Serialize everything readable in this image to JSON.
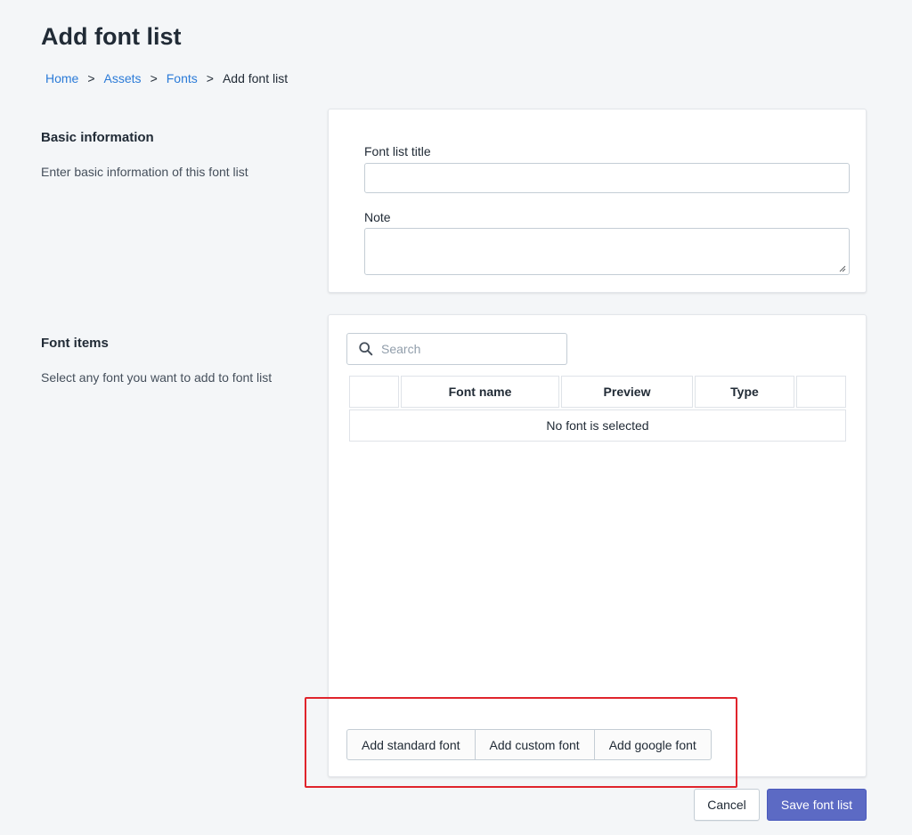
{
  "page": {
    "title": "Add font list"
  },
  "breadcrumb": {
    "items": [
      {
        "label": "Home",
        "link": true
      },
      {
        "label": "Assets",
        "link": true
      },
      {
        "label": "Fonts",
        "link": true
      },
      {
        "label": "Add font list",
        "link": false
      }
    ],
    "separator": ">"
  },
  "basic_info": {
    "heading": "Basic information",
    "description": "Enter basic information of this font list",
    "title_label": "Font list title",
    "title_value": "",
    "note_label": "Note",
    "note_value": ""
  },
  "font_items": {
    "heading": "Font items",
    "description": "Select any font you want to add to font list",
    "search_placeholder": "Search",
    "columns": [
      "",
      "Font name",
      "Preview",
      "Type",
      ""
    ],
    "empty_message": "No font is selected",
    "add_standard_label": "Add standard font",
    "add_custom_label": "Add custom font",
    "add_google_label": "Add google font"
  },
  "footer": {
    "cancel_label": "Cancel",
    "save_label": "Save font list"
  },
  "colors": {
    "link": "#2b7bd8",
    "primary": "#5c6ac4",
    "highlight": "#e0242c",
    "background": "#f4f6f8"
  }
}
